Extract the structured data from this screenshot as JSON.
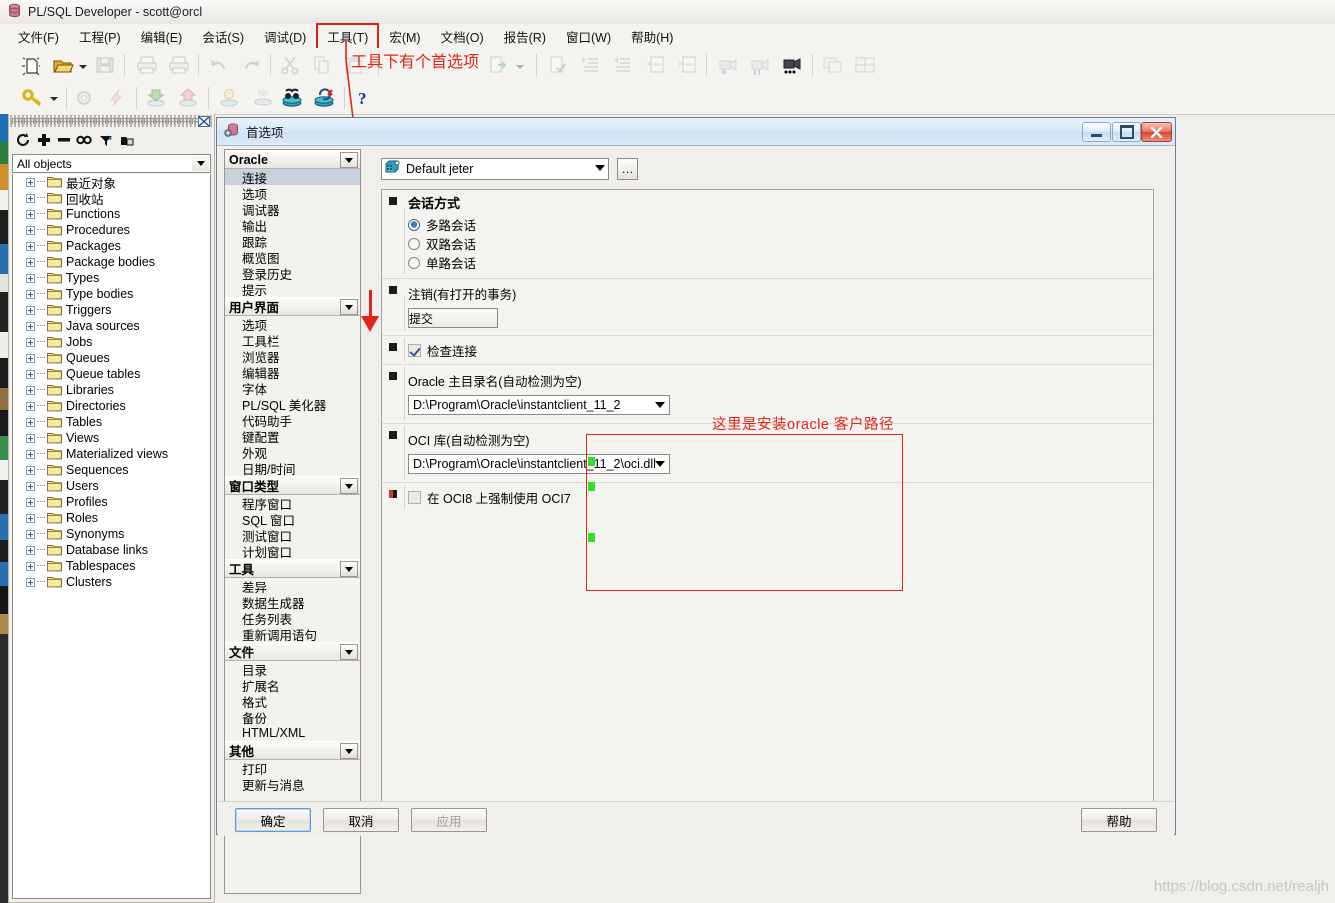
{
  "window": {
    "title": "PL/SQL Developer - scott@orcl",
    "icon": "database-icon"
  },
  "menubar": {
    "items": [
      {
        "label": "文件(F)",
        "boxed": false
      },
      {
        "label": "工程(P)",
        "boxed": false
      },
      {
        "label": "编辑(E)",
        "boxed": false
      },
      {
        "label": "会话(S)",
        "boxed": false
      },
      {
        "label": "调试(D)",
        "boxed": false
      },
      {
        "label": "工具(T)",
        "boxed": true
      },
      {
        "label": "宏(M)",
        "boxed": false
      },
      {
        "label": "文档(O)",
        "boxed": false
      },
      {
        "label": "报告(R)",
        "boxed": false
      },
      {
        "label": "窗口(W)",
        "boxed": false
      },
      {
        "label": "帮助(H)",
        "boxed": false
      }
    ]
  },
  "annotations": {
    "tools_hint": "工具下有个首选项",
    "path_hint": "这里是安装oracle 客户路径",
    "color": "#e2251b"
  },
  "browser": {
    "filter": {
      "value": "All objects"
    },
    "tools": [
      "refresh-icon",
      "expand-icon",
      "collapse-icon",
      "find-icon",
      "filter-icon",
      "folder-config-icon"
    ],
    "tree": [
      "最近对象",
      "回收站",
      "Functions",
      "Procedures",
      "Packages",
      "Package bodies",
      "Types",
      "Type bodies",
      "Triggers",
      "Java sources",
      "Jobs",
      "Queues",
      "Queue tables",
      "Libraries",
      "Directories",
      "Tables",
      "Views",
      "Materialized views",
      "Sequences",
      "Users",
      "Profiles",
      "Roles",
      "Synonyms",
      "Database links",
      "Tablespaces",
      "Clusters"
    ]
  },
  "dialog": {
    "title": "首选项",
    "titlebar_buttons": [
      {
        "name": "minimize-button",
        "glyph": "—"
      },
      {
        "name": "maximize-button",
        "glyph": "❐"
      },
      {
        "name": "close-button",
        "glyph": "✕"
      }
    ],
    "connection": {
      "value": "Default jeter",
      "ellipsis_label": "…"
    },
    "categories": [
      {
        "header": "Oracle",
        "items": [
          "连接",
          "选项",
          "调试器",
          "输出",
          "跟踪",
          "概览图",
          "登录历史",
          "提示"
        ],
        "selected": "连接"
      },
      {
        "header": "用户界面",
        "items": [
          "选项",
          "工具栏",
          "浏览器",
          "编辑器",
          "字体",
          "PL/SQL 美化器",
          "代码助手",
          "键配置",
          "外观",
          "日期/时间"
        ],
        "selected": null
      },
      {
        "header": "窗口类型",
        "items": [
          "程序窗口",
          "SQL 窗口",
          "测试窗口",
          "计划窗口"
        ],
        "selected": null
      },
      {
        "header": "工具",
        "items": [
          "差异",
          "数据生成器",
          "任务列表",
          "重新调用语句"
        ],
        "selected": null
      },
      {
        "header": "文件",
        "items": [
          "目录",
          "扩展名",
          "格式",
          "备份",
          "HTML/XML"
        ],
        "selected": null
      },
      {
        "header": "其他",
        "items": [
          "打印",
          "更新与消息"
        ],
        "selected": null
      }
    ],
    "settings": {
      "session_mode": {
        "title": "会话方式",
        "options": [
          {
            "label": "多路会话",
            "selected": true
          },
          {
            "label": "双路会话",
            "selected": false
          },
          {
            "label": "单路会话",
            "selected": false
          }
        ]
      },
      "logoff": {
        "title": "注销(有打开的事务)",
        "value": "提交"
      },
      "check_connection": {
        "label": "检查连接",
        "checked": true
      },
      "oracle_home": {
        "label": "Oracle 主目录名(自动检测为空)",
        "value": "D:\\Program\\Oracle\\instantclient_11_2"
      },
      "oci_library": {
        "label": "OCI 库(自动检测为空)",
        "value": "D:\\Program\\Oracle\\instantclient_11_2\\oci.dll"
      },
      "force_oci7": {
        "label": "在 OCI8 上强制使用 OCI7",
        "checked": false
      }
    },
    "buttons": [
      {
        "name": "ok-button",
        "label": "确定",
        "state": "default"
      },
      {
        "name": "cancel-button",
        "label": "取消",
        "state": "normal"
      },
      {
        "name": "apply-button",
        "label": "应用",
        "state": "disabled"
      },
      {
        "name": "help-button",
        "label": "帮助",
        "state": "normal"
      }
    ]
  },
  "watermark": "https://blog.csdn.net/realjh"
}
